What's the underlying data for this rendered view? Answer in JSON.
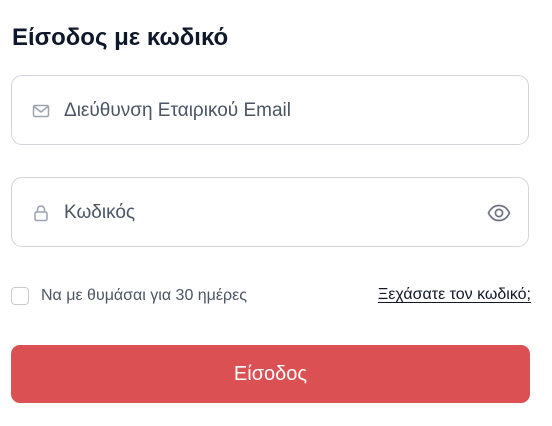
{
  "form": {
    "title": "Είσοδος με κωδικό",
    "email": {
      "placeholder": "Διεύθυνση Εταιρικού Email",
      "icon": "mail-icon"
    },
    "password": {
      "placeholder": "Κωδικός",
      "icon": "lock-icon",
      "toggle_icon": "eye-icon"
    },
    "remember_label": "Να με θυμάσαι για 30 ημέρες",
    "forgot_link": "Ξεχάσατε τον κωδικό;",
    "submit_label": "Είσοδος"
  },
  "colors": {
    "accent": "#db5053",
    "title": "#0f172a",
    "border": "#d1d5db",
    "muted_text": "#4b5563"
  }
}
